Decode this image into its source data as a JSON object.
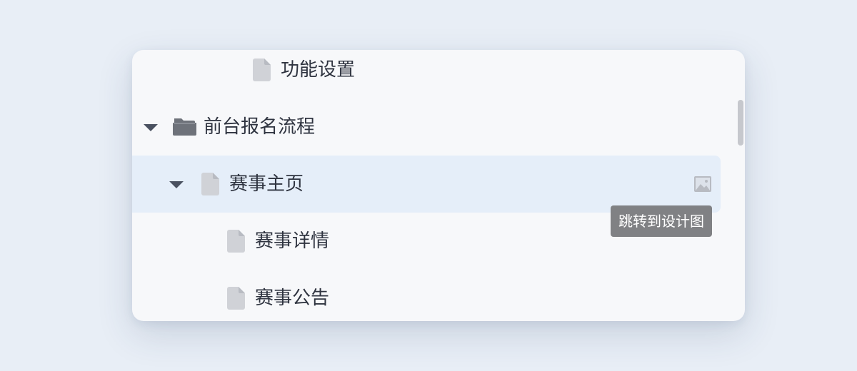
{
  "tree": {
    "rows": [
      {
        "label": "功能设置",
        "type": "file",
        "level": 3,
        "expanded": null,
        "selected": false
      },
      {
        "label": "前台报名流程",
        "type": "folder",
        "level": 1,
        "expanded": true,
        "selected": false
      },
      {
        "label": "赛事主页",
        "type": "file",
        "level": 2,
        "expanded": true,
        "selected": true
      },
      {
        "label": "赛事详情",
        "type": "file",
        "level": 3,
        "expanded": null,
        "selected": false
      },
      {
        "label": "赛事公告",
        "type": "file",
        "level": 3,
        "expanded": null,
        "selected": false
      }
    ]
  },
  "tooltip": {
    "text": "跳转到设计图"
  },
  "icons": {
    "file": "file-icon",
    "folder": "folder-open-icon",
    "expand": "caret-down-icon",
    "design": "image-icon"
  },
  "colors": {
    "background": "#e8eef6",
    "panel": "#f7f8fa",
    "selected_row": "#e5eef9",
    "file_icon": "#d0d2d7",
    "folder_icon": "#6e727a",
    "text": "#2f3440",
    "tooltip_bg": "#808184"
  }
}
